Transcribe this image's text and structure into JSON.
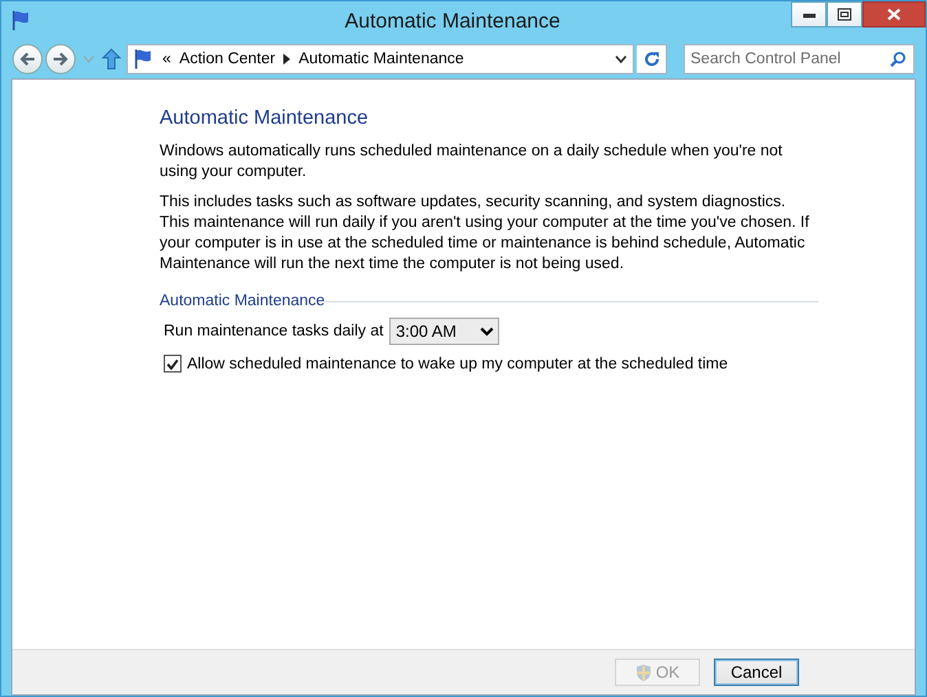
{
  "window": {
    "title": "Automatic Maintenance"
  },
  "address_bar": {
    "overflow": "«",
    "crumbs": [
      "Action Center",
      "Automatic Maintenance"
    ]
  },
  "search": {
    "placeholder": "Search Control Panel"
  },
  "content": {
    "heading": "Automatic Maintenance",
    "paragraphs": [
      "Windows automatically runs scheduled maintenance on a daily schedule when you're not using your computer.",
      "This includes tasks such as software updates, security scanning, and system diagnostics. This maintenance will run daily if you aren't using your computer at the time you've chosen. If your computer is in use at the scheduled time or maintenance is behind schedule, Automatic Maintenance will run the next time the computer is not being used."
    ],
    "group_label": "Automatic Maintenance",
    "schedule": {
      "label": "Run maintenance tasks daily at",
      "value": "3:00 AM"
    },
    "wake": {
      "label": "Allow scheduled maintenance to wake up my computer at the scheduled time",
      "checked": true
    }
  },
  "buttons": [
    {
      "label": "OK",
      "disabled": true,
      "shield": true,
      "default": false
    },
    {
      "label": "Cancel",
      "disabled": false,
      "shield": false,
      "default": true
    }
  ]
}
